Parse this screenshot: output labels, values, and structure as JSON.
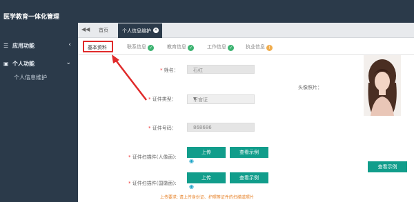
{
  "sidebar": {
    "brand": "医学教育一体化管理",
    "items": [
      {
        "label": "应用功能",
        "arrow": "‹"
      },
      {
        "label": "个人功能",
        "arrow": "⌄"
      }
    ],
    "sub_items": [
      {
        "label": "个人信息维护"
      }
    ]
  },
  "tabs": {
    "back": "◀◀",
    "home": "首页",
    "active": "个人信息维护",
    "close": "×"
  },
  "steps": [
    {
      "label": "基本资料",
      "status": "active"
    },
    {
      "label": "联系信息",
      "status": "done"
    },
    {
      "label": "教育信息",
      "status": "done"
    },
    {
      "label": "工作信息",
      "status": "done"
    },
    {
      "label": "执业信息",
      "status": "warning"
    }
  ],
  "form": {
    "name_label": "姓名：",
    "name_value": "石红",
    "photo_label": "头像照片：",
    "id_type_label": "证件类型：",
    "id_type_value": "军官证",
    "id_number_label": "证件号码：",
    "id_number_value": "868686",
    "scan_front_label": "证件扫描件(人像面):",
    "scan_back_label": "证件扫描件(国徽面):",
    "upload_label": "上传",
    "example_label": "查看示例",
    "photo_example_label": "查看示例",
    "note": "上传要求: 请上传身份证、护照等证件的扫描或照片"
  },
  "colors": {
    "sidebar_bg": "#2b3a4a",
    "accent": "#119d8b",
    "highlight": "#e02a2a",
    "ok": "#3cb371",
    "warn": "#f0ad4e"
  }
}
